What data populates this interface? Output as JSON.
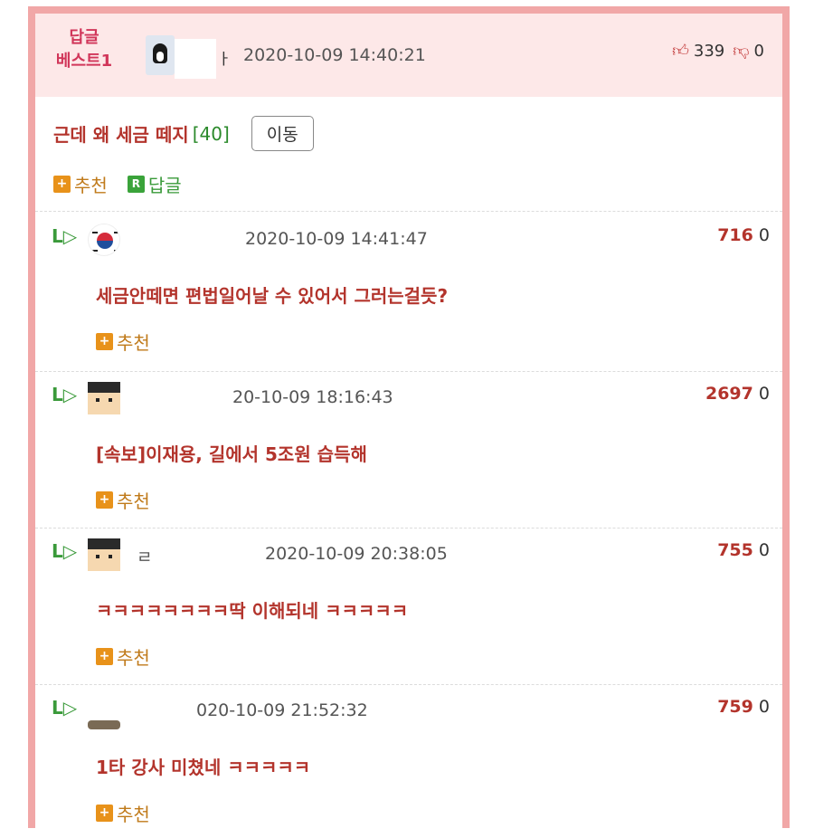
{
  "best": {
    "label_line1": "답글",
    "label_line2": "베스트1",
    "nick_tail": "ㅏ",
    "timestamp": "2020-10-09 14:40:21",
    "upvotes": "339",
    "downvotes": "0"
  },
  "post": {
    "title": "근데 왜 세금 떼지",
    "count": "[40]",
    "move_label": "이동",
    "recommend_label": "추천",
    "reply_label": "답글",
    "reply_icon_letter": "R"
  },
  "replies": [
    {
      "timestamp": "2020-10-09 14:41:47",
      "up": "716",
      "down": "0",
      "text": "세금안떼면 편법일어날 수 있어서 그러는걸듯?",
      "recommend": "추천",
      "avatar": "korea-flag-icon"
    },
    {
      "timestamp": "20-10-09 18:16:43",
      "up": "2697",
      "down": "0",
      "text": "[속보]이재용, 길에서 5조원 습득해",
      "recommend": "추천",
      "avatar": "pixel-face-icon"
    },
    {
      "nick": "ㄹ",
      "timestamp": "2020-10-09 20:38:05",
      "up": "755",
      "down": "0",
      "text": "ㅋㅋㅋㅋㅋㅋㅋㅋ딱 이해되네 ㅋㅋㅋㅋㅋ",
      "recommend": "추천",
      "avatar": "pixel-face-icon"
    },
    {
      "timestamp": "020-10-09 21:52:32",
      "up": "759",
      "down": "0",
      "text": "1타 강사 미쳤네 ㅋㅋㅋㅋㅋ",
      "recommend": "추천",
      "avatar": "avatar"
    }
  ],
  "colors": {
    "accent": "#b3342c",
    "frame": "#f1a7a7",
    "header_bg": "#fde8e8",
    "green": "#3a9a3a",
    "orange": "#e8921a"
  }
}
